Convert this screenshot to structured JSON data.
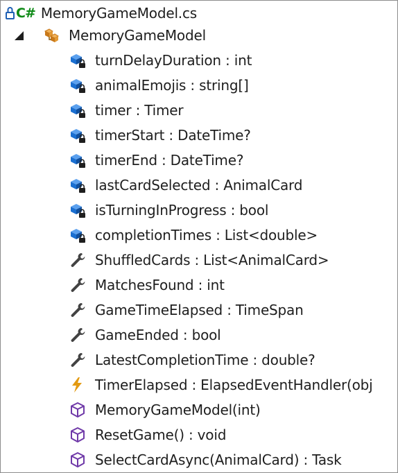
{
  "file": {
    "cs_badge": "C#",
    "name": "MemoryGameModel.cs"
  },
  "class_node": {
    "name": "MemoryGameModel"
  },
  "members": [
    {
      "label": "turnDelayDuration : int",
      "icon": "private-field-icon"
    },
    {
      "label": "animalEmojis : string[]",
      "icon": "private-field-icon"
    },
    {
      "label": "timer : Timer",
      "icon": "private-field-icon"
    },
    {
      "label": "timerStart : DateTime?",
      "icon": "private-field-icon"
    },
    {
      "label": "timerEnd : DateTime?",
      "icon": "private-field-icon"
    },
    {
      "label": "lastCardSelected : AnimalCard",
      "icon": "private-field-icon"
    },
    {
      "label": "isTurningInProgress : bool",
      "icon": "private-field-icon"
    },
    {
      "label": "completionTimes : List<double>",
      "icon": "private-field-icon"
    },
    {
      "label": "ShuffledCards : List<AnimalCard>",
      "icon": "property-wrench-icon"
    },
    {
      "label": "MatchesFound : int",
      "icon": "property-wrench-icon"
    },
    {
      "label": "GameTimeElapsed : TimeSpan",
      "icon": "property-wrench-icon"
    },
    {
      "label": "GameEnded : bool",
      "icon": "property-wrench-icon"
    },
    {
      "label": "LatestCompletionTime : double?",
      "icon": "property-wrench-icon"
    },
    {
      "label": "TimerElapsed : ElapsedEventHandler(obj",
      "icon": "event-lightning-icon"
    },
    {
      "label": "MemoryGameModel(int)",
      "icon": "method-cube-icon"
    },
    {
      "label": "ResetGame() : void",
      "icon": "method-cube-icon"
    },
    {
      "label": "SelectCardAsync(AnimalCard) : Task",
      "icon": "method-cube-icon"
    }
  ],
  "colors": {
    "field_blue": "#1a6fd1",
    "property_gray": "#424242",
    "event_orange": "#e39a12",
    "method_purple": "#6f39a8",
    "class_orange": "#c8781a",
    "cs_green": "#0e8a16",
    "lock_blue": "#1e5fb4"
  }
}
